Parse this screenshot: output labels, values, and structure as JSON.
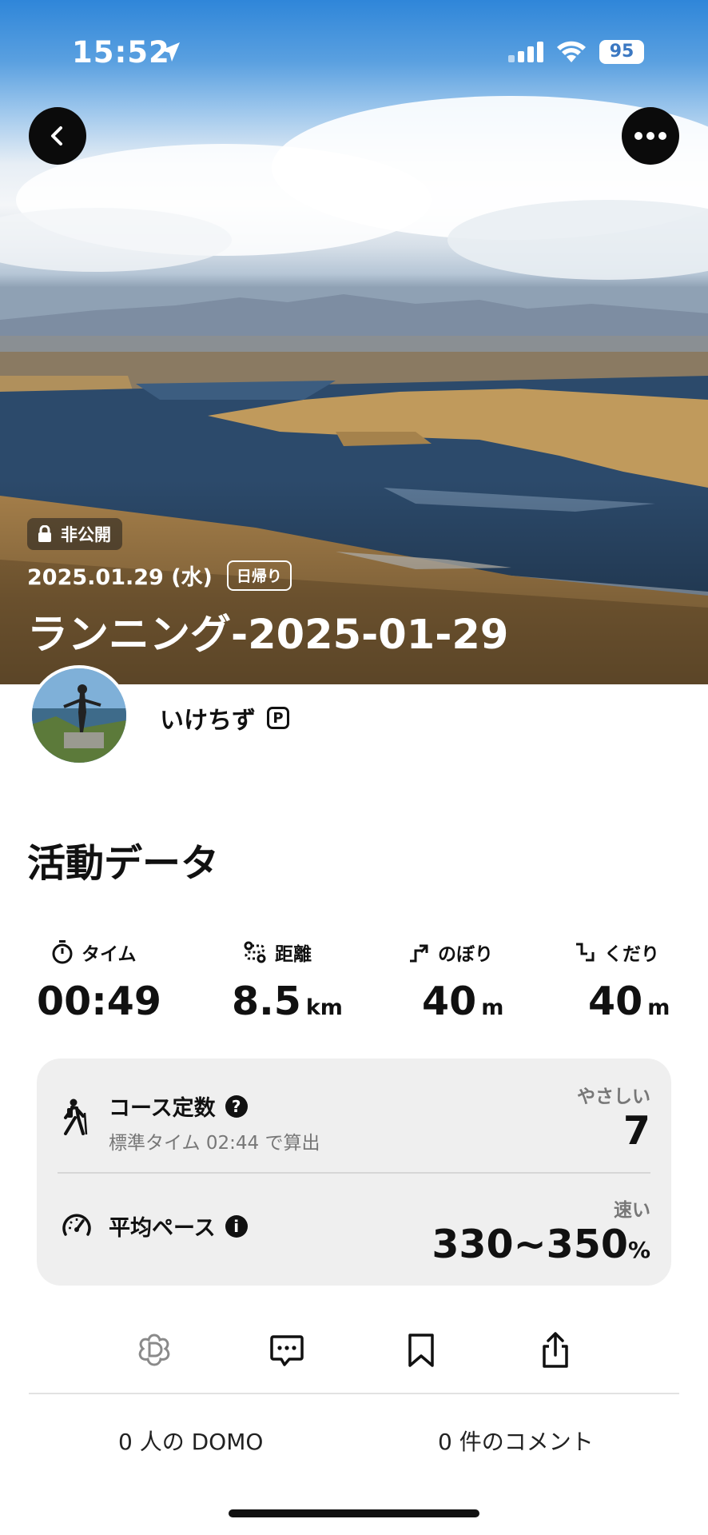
{
  "status_bar": {
    "time": "15:52",
    "battery": "95"
  },
  "hero": {
    "private_label": "非公開",
    "date": "2025.01.29 (水)",
    "trip_badge": "日帰り",
    "title": "ランニング-2025-01-29"
  },
  "user": {
    "name": "いけちず",
    "premium_badge": "P"
  },
  "section_title": "活動データ",
  "stats": [
    {
      "label": "タイム",
      "value": "00:49",
      "unit": "",
      "icon": "stopwatch-icon"
    },
    {
      "label": "距離",
      "value": "8.5",
      "unit": "km",
      "icon": "route-icon"
    },
    {
      "label": "のぼり",
      "value": "40",
      "unit": "m",
      "icon": "ascent-icon"
    },
    {
      "label": "くだり",
      "value": "40",
      "unit": "m",
      "icon": "descent-icon"
    }
  ],
  "course": {
    "label": "コース定数",
    "sub": "標準タイム 02:44 で算出",
    "difficulty": "やさしい",
    "value": "7"
  },
  "pace": {
    "label": "平均ペース",
    "speed_label": "速い",
    "value": "330~350",
    "unit": "%"
  },
  "footer": {
    "domo_count": "0 人の DOMO",
    "comment_count": "0 件のコメント"
  }
}
